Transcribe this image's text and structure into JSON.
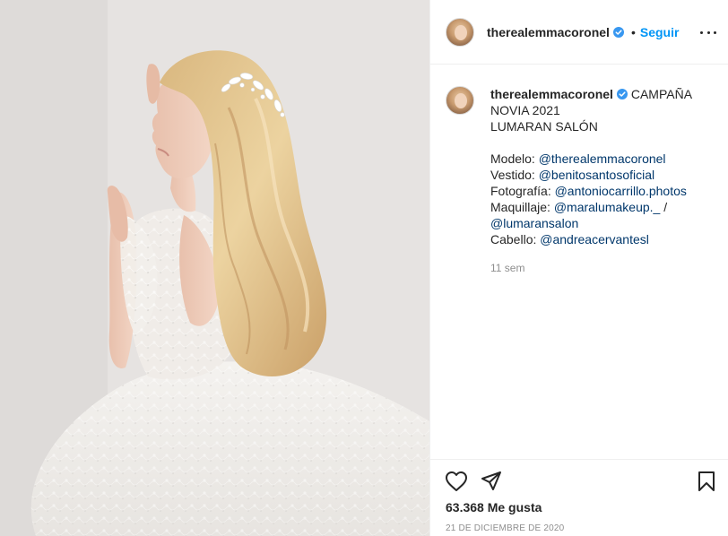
{
  "post": {
    "photo_alt": "Bride in lace wedding dress leaning against wall"
  },
  "header": {
    "username": "therealemmacoronel",
    "separator": "•",
    "follow_label": "Seguir"
  },
  "caption": {
    "username": "therealemmacoronel",
    "title_line1": "CAMPAÑA",
    "title_line2": "NOVIA 2021",
    "title_line3": "LUMARAN SALÓN",
    "credits": [
      {
        "label": "Modelo:",
        "handle": "@therealemmacoronel"
      },
      {
        "label": "Vestido:",
        "handle": "@benitosantosoficial"
      },
      {
        "label": "Fotografía:",
        "handle": "@antoniocarrillo.photos"
      },
      {
        "label": "Maquillaje:",
        "handle": "@maralumakeup._",
        "suffix": " /"
      },
      {
        "label": "",
        "handle": "@lumaransalon"
      },
      {
        "label": "Cabello:",
        "handle": "@andreacervantesl"
      }
    ],
    "time_ago": "11 sem"
  },
  "footer": {
    "likes": "63.368 Me gusta",
    "date": "21 DE DICIEMBRE DE 2020"
  },
  "icons": {
    "verified": "verified-badge-icon",
    "like": "heart-icon",
    "share": "paper-plane-icon",
    "save": "bookmark-icon",
    "more": "more-options-icon"
  },
  "colors": {
    "link": "#00376b",
    "follow": "#0095f6",
    "verified": "#3897f0",
    "muted": "#8e8e8e",
    "text": "#262626"
  }
}
